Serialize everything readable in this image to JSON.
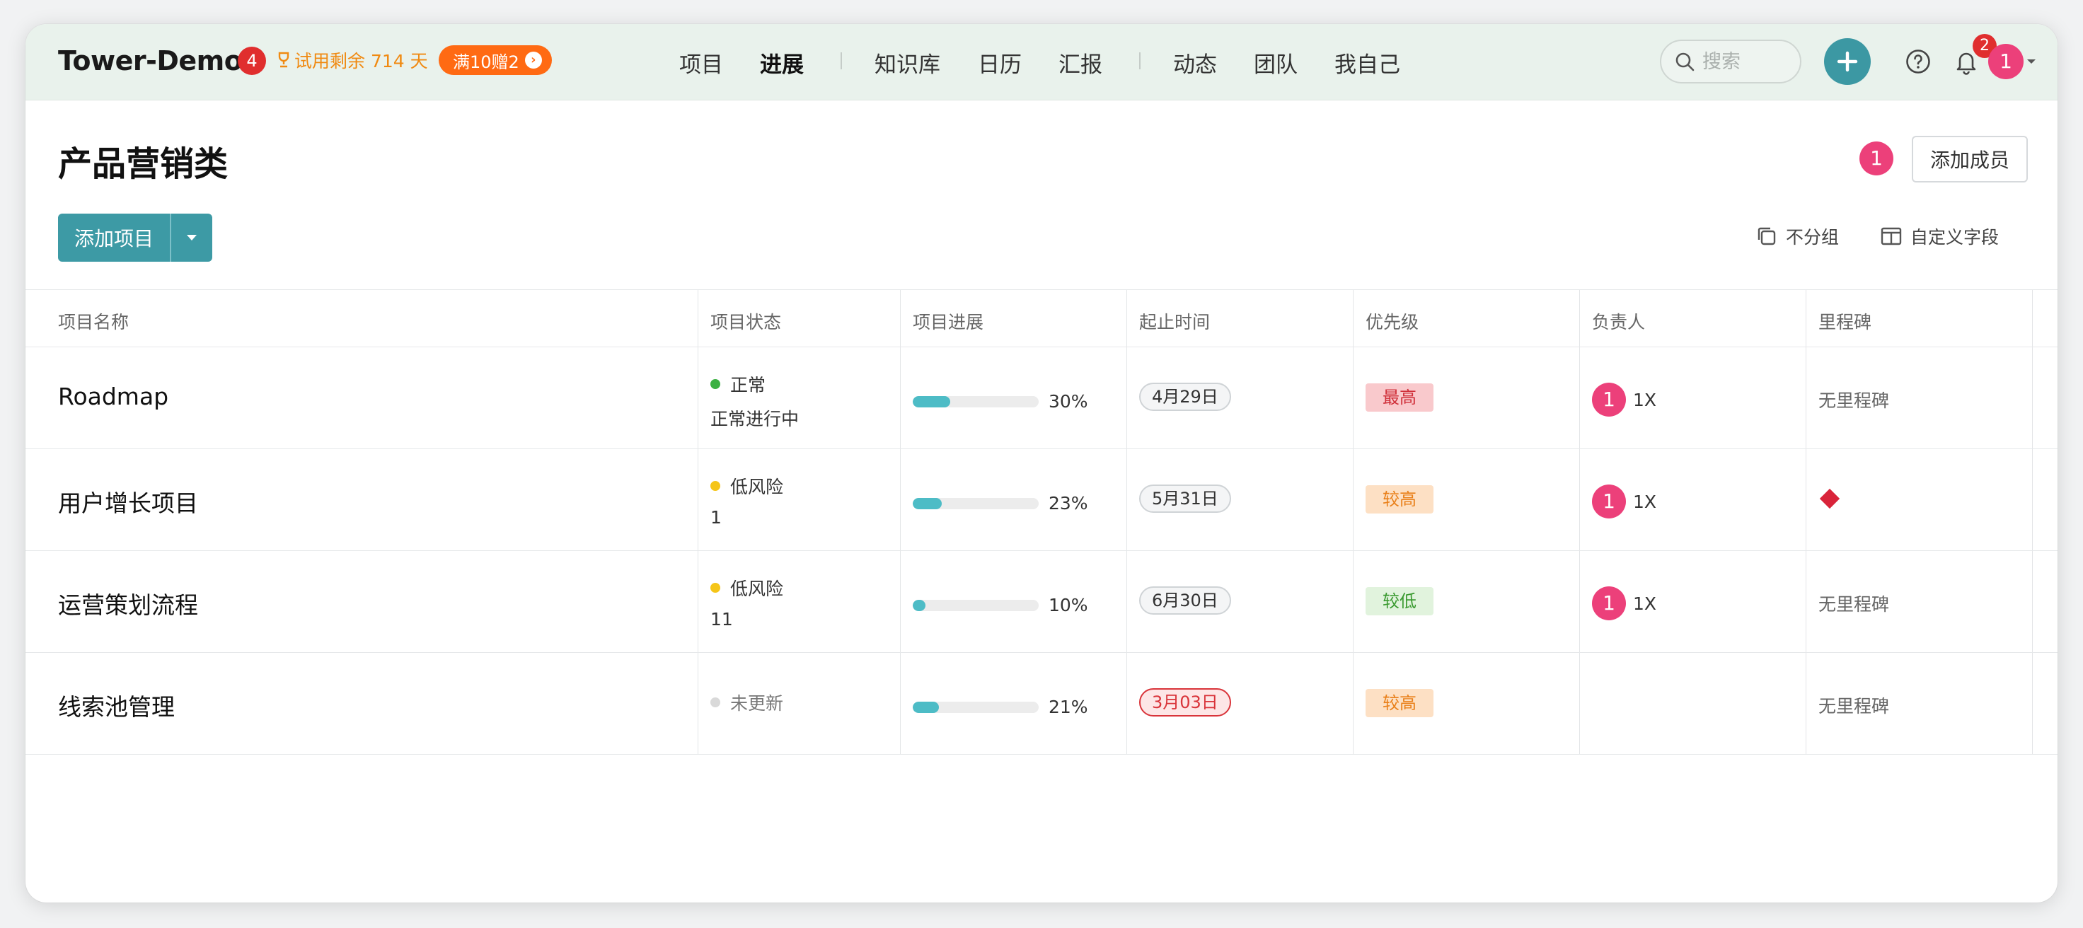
{
  "header": {
    "brand": "Tower-Demo",
    "brand_badge": "4",
    "trial_text": "试用剩余 714 天",
    "promo_label": "满10赠2",
    "nav": [
      "项目",
      "进展",
      "知识库",
      "日历",
      "汇报",
      "动态",
      "团队",
      "我自己"
    ],
    "active_nav": "进展",
    "search_placeholder": "搜索",
    "notification_count": "2",
    "user_avatar": "1"
  },
  "page": {
    "title": "产品营销类",
    "member_avatar": "1",
    "add_member_label": "添加成员",
    "add_project_label": "添加项目",
    "group_label": "不分组",
    "custom_fields_label": "自定义字段"
  },
  "table": {
    "columns": [
      "项目名称",
      "项目状态",
      "项目进展",
      "起止时间",
      "优先级",
      "负责人",
      "里程碑"
    ],
    "rows": [
      {
        "name": "Roadmap",
        "status": "正常",
        "status_color": "#3cb043",
        "status_note": "正常进行中",
        "progress": 30,
        "progress_label": "30%",
        "date": "4月29日",
        "overdue": false,
        "priority": "最高",
        "priority_bg": "#f9c9cc",
        "priority_fg": "#d0303a",
        "owner_avatar": "1",
        "owner_name": "1X",
        "milestone": "无里程碑"
      },
      {
        "name": "用户增长项目",
        "status": "低风险",
        "status_color": "#f5c518",
        "status_note": "1",
        "progress": 23,
        "progress_label": "23%",
        "date": "5月31日",
        "overdue": false,
        "priority": "较高",
        "priority_bg": "#fde0c4",
        "priority_fg": "#e9801a",
        "owner_avatar": "1",
        "owner_name": "1X",
        "milestone": ""
      },
      {
        "name": "运营策划流程",
        "status": "低风险",
        "status_color": "#f5c518",
        "status_note": "11",
        "progress": 10,
        "progress_label": "10%",
        "date": "6月30日",
        "overdue": false,
        "priority": "较低",
        "priority_bg": "#e1f3dd",
        "priority_fg": "#3a9a30",
        "owner_avatar": "1",
        "owner_name": "1X",
        "milestone": "无里程碑"
      },
      {
        "name": "线索池管理",
        "status": "未更新",
        "status_color": "#d9d9d9",
        "status_note": "",
        "progress": 21,
        "progress_label": "21%",
        "date": "3月03日",
        "overdue": true,
        "priority": "较高",
        "priority_bg": "#fde0c4",
        "priority_fg": "#e9801a",
        "owner_avatar": "",
        "owner_name": "",
        "milestone": "无里程碑"
      }
    ]
  },
  "colors": {
    "accent": "#3d9aa5",
    "header_bg": "#e9f2ec",
    "avatar": "#ec407a",
    "badge": "#e02e2e",
    "promo": "#ff6a13"
  }
}
